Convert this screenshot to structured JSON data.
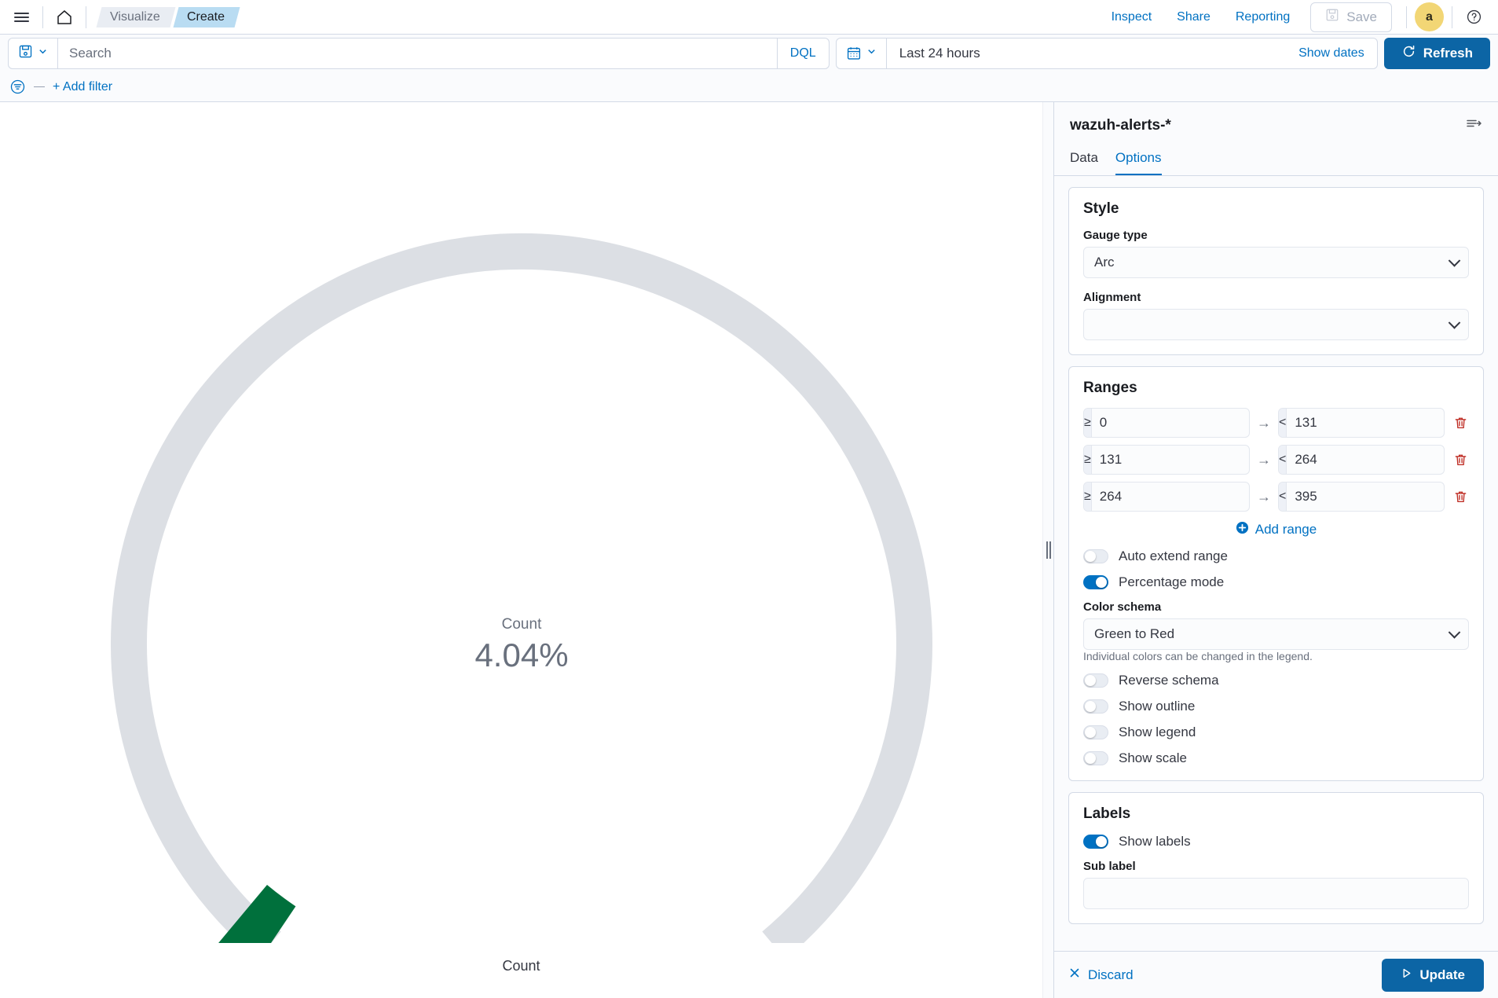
{
  "header": {
    "menu_icon": "hamburger-icon",
    "home_icon": "home-icon",
    "breadcrumbs": [
      {
        "label": "Visualize",
        "active": false
      },
      {
        "label": "Create",
        "active": true
      }
    ],
    "links": [
      {
        "label": "Inspect"
      },
      {
        "label": "Share"
      },
      {
        "label": "Reporting"
      }
    ],
    "save_label": "Save",
    "save_icon": "save-disk-icon",
    "avatar_initial": "a",
    "avatar_color": "#f2d675",
    "help_icon": "help-circle-icon"
  },
  "query_bar": {
    "saved_query_icon": "saved-query-disk-icon",
    "search_value": "",
    "search_placeholder": "Search",
    "language_badge": "DQL",
    "calendar_icon": "calendar-icon",
    "date_range": "Last 24 hours",
    "show_dates_label": "Show dates",
    "refresh_label": "Refresh",
    "refresh_icon": "refresh-icon"
  },
  "filter_bar": {
    "filter_icon": "filter-icon",
    "add_filter_label": "+ Add filter"
  },
  "chart_data": {
    "type": "gauge",
    "title": "Count",
    "center_label": "Count",
    "center_value": "4.04%",
    "bottom_label": "Count",
    "percent": 4.04,
    "min": 0,
    "max": 395,
    "gauge_type": "Arc",
    "track_color": "#dcdfe4",
    "value_color": "#00703c",
    "legend": false,
    "scale": false
  },
  "side_panel": {
    "title": "wazuh-alerts-*",
    "collapse_icon": "collapse-panel-icon",
    "tabs": [
      {
        "label": "Data",
        "active": false
      },
      {
        "label": "Options",
        "active": true
      }
    ],
    "style": {
      "section_title": "Style",
      "gauge_type_label": "Gauge type",
      "gauge_type_value": "Arc",
      "alignment_label": "Alignment",
      "alignment_value": ""
    },
    "ranges": {
      "section_title": "Ranges",
      "from_prefix": "≥",
      "to_prefix": "<",
      "arrow": "→",
      "rows": [
        {
          "from": "0",
          "to": "131"
        },
        {
          "from": "131",
          "to": "264"
        },
        {
          "from": "264",
          "to": "395"
        }
      ],
      "add_range_label": "Add range",
      "delete_icon": "trash-icon",
      "auto_extend_label": "Auto extend range",
      "auto_extend_on": false,
      "percentage_mode_label": "Percentage mode",
      "percentage_mode_on": true,
      "color_schema_label": "Color schema",
      "color_schema_value": "Green to Red",
      "color_schema_hint": "Individual colors can be changed in the legend.",
      "reverse_schema_label": "Reverse schema",
      "reverse_schema_on": false,
      "show_outline_label": "Show outline",
      "show_outline_on": false,
      "show_legend_label": "Show legend",
      "show_legend_on": false,
      "show_scale_label": "Show scale",
      "show_scale_on": false
    },
    "labels": {
      "section_title": "Labels",
      "show_labels_label": "Show labels",
      "show_labels_on": true,
      "sub_label_label": "Sub label",
      "sub_label_value": ""
    },
    "footer": {
      "discard_label": "Discard",
      "update_label": "Update"
    }
  }
}
